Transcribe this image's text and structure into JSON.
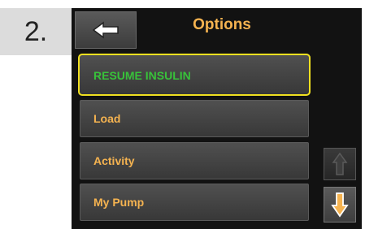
{
  "step": {
    "label": "2."
  },
  "header": {
    "title": "Options",
    "back_icon": "arrow-left-icon"
  },
  "menu": {
    "items": [
      {
        "label": "RESUME INSULIN",
        "selected": true,
        "color": "#38c23a"
      },
      {
        "label": "Load",
        "selected": false,
        "color": "#f5b350"
      },
      {
        "label": "Activity",
        "selected": false,
        "color": "#f5b350"
      },
      {
        "label": "My Pump",
        "selected": false,
        "color": "#f5b350"
      }
    ],
    "highlight_color": "#f0e020"
  },
  "scroll": {
    "up_icon": "arrow-up-icon",
    "down_icon": "arrow-down-icon",
    "up_enabled": false,
    "down_enabled": true
  }
}
